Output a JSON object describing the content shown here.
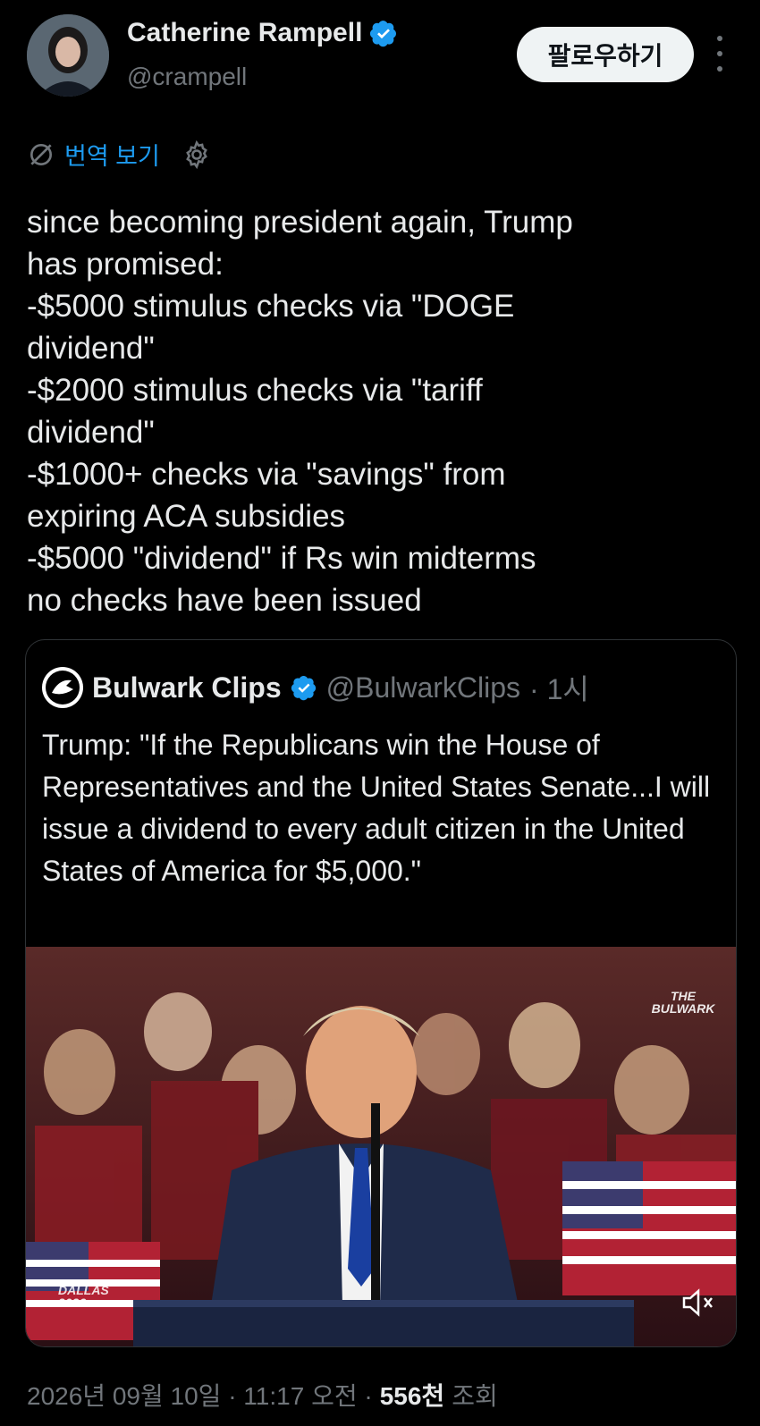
{
  "author": {
    "name": "Catherine Rampell",
    "handle": "@crampell",
    "verified": true
  },
  "follow_label": "팔로우하기",
  "translate_label": "번역 보기",
  "tweet_text": "since becoming president again, Trump\nhas promised:\n-$5000 stimulus checks via \"DOGE\ndividend\"\n-$2000 stimulus checks via \"tariff\ndividend\"\n-$1000+ checks via \"savings\" from\nexpiring ACA subsidies\n-$5000 \"dividend\" if Rs win midterms\nno checks have been issued",
  "quote": {
    "name": "Bulwark Clips",
    "handle": "@BulwarkClips",
    "time": "· 1시",
    "text": "Trump: \"If the Republicans win the House of Representatives and the United States Senate...I will issue a dividend to every adult citizen in the United States of America for $5,000.\"",
    "watermark": "THE BULWARK",
    "event_badge": "DALLAS 2026"
  },
  "footer": {
    "date": "2026년 09월 10일 · 11:17 오전 ·",
    "views_num": "556천",
    "views_label": "조회"
  },
  "colors": {
    "accent": "#1d9bf0",
    "text": "#e7e9ea",
    "muted": "#71767b",
    "background": "#000000"
  },
  "icons": [
    "verified-badge-icon",
    "more-options-icon",
    "translate-icon",
    "gear-icon",
    "bulwark-logo-icon",
    "mute-icon"
  ]
}
